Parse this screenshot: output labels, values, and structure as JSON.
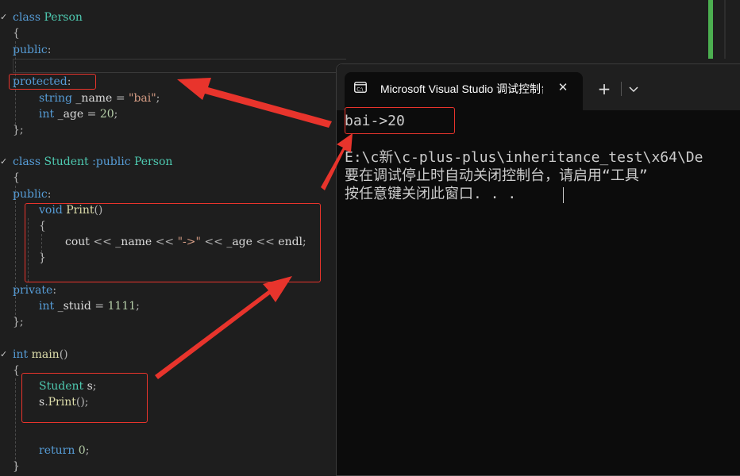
{
  "editor": {
    "lines": [
      [
        "class",
        "Person"
      ],
      [
        "{"
      ],
      [
        "public",
        ":"
      ],
      [
        ""
      ],
      [
        "protected",
        ":"
      ],
      [
        "string",
        "_name",
        "=",
        "\"bai\"",
        ";"
      ],
      [
        "int",
        "_age",
        "=",
        "20",
        ";"
      ],
      [
        "};"
      ],
      [
        ""
      ],
      [
        "class",
        "Student",
        ":public",
        "Person"
      ],
      [
        "{"
      ],
      [
        "public",
        ":"
      ],
      [
        "void",
        "Print",
        "()"
      ],
      [
        "{"
      ],
      [
        "cout",
        "<<",
        "_name",
        "<<",
        "\"->\"",
        "<<",
        "_age",
        "<<",
        "endl",
        ";"
      ],
      [
        "}"
      ],
      [
        ""
      ],
      [
        "private",
        ":"
      ],
      [
        "int",
        "_stuid",
        "=",
        "1111",
        ";"
      ],
      [
        "};"
      ],
      [
        ""
      ],
      [
        "int",
        "main",
        "()"
      ],
      [
        "{"
      ],
      [
        "Student",
        "s",
        ";"
      ],
      [
        "s",
        ".",
        "Print",
        "();"
      ],
      [
        ""
      ],
      [
        ""
      ],
      [
        "return",
        "0",
        ";"
      ],
      [
        "}"
      ]
    ]
  },
  "console": {
    "tab_title": "Microsoft Visual Studio 调试控制台",
    "tab_icon": "terminal-icon",
    "close_glyph": "✕",
    "new_tab_glyph": "+",
    "output": [
      "bai->20",
      "",
      "E:\\c新\\c-plus-plus\\inheritance_test\\x64\\De",
      "要在调试停止时自动关闭控制台，请启用“工具”",
      "按任意键关闭此窗口. . ."
    ]
  },
  "colors": {
    "annotation": "#e8342c",
    "keyword": "#569cd6",
    "type": "#4ec9b0",
    "function": "#dcdcaa",
    "string": "#d69d85",
    "number": "#b5cea8",
    "console_bg": "#0c0c0c",
    "editor_bg": "#1e1e1e",
    "scrollbar_change": "#4caf50"
  }
}
